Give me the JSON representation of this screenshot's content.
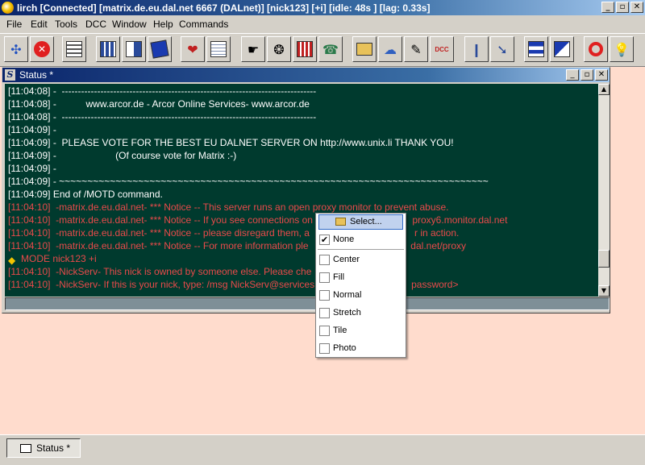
{
  "window": {
    "title": "lirch [Connected] [matrix.de.eu.dal.net 6667 (DALnet)] [nick123] [+i] [idle: 48s ] [lag: 0.33s]",
    "minimize_glyph": "_",
    "maximize_glyph": "▫",
    "close_glyph": "✕"
  },
  "menu": {
    "items": [
      "File",
      "Edit",
      "Tools",
      "DCC",
      "Window",
      "Help",
      "Commands"
    ]
  },
  "toolbar": {
    "buttons": [
      {
        "icon": "connect-icon"
      },
      {
        "icon": "disconnect-icon"
      },
      {
        "icon": "options-icon"
      },
      {
        "icon": "channels-list-icon"
      },
      {
        "icon": "channel-folder-icon"
      },
      {
        "icon": "notify-icon"
      },
      {
        "icon": "address-book-icon"
      },
      {
        "icon": "log-icon"
      },
      {
        "icon": "url-catcher-icon"
      },
      {
        "icon": "scripts-icon"
      },
      {
        "icon": "colors-icon"
      },
      {
        "icon": "dcc-chat-icon"
      },
      {
        "icon": "folder-icon"
      },
      {
        "icon": "query-icon"
      },
      {
        "icon": "edit-icon"
      },
      {
        "icon": "dcc-send-icon"
      },
      {
        "icon": "highlight-icon"
      },
      {
        "icon": "arrange-icon"
      },
      {
        "icon": "tile-horizontal-icon"
      },
      {
        "icon": "tile-cascade-icon"
      },
      {
        "icon": "help-icon"
      },
      {
        "icon": "tips-icon"
      }
    ],
    "dcc_label": "DCC"
  },
  "status_window": {
    "title": "Status *",
    "icon_letter": "S",
    "lines": [
      {
        "text": "[11:04:08] -  -------------------------------------------------------------------------------",
        "color": "white"
      },
      {
        "text": "[11:04:08] -           www.arcor.de - Arcor Online Services- www.arcor.de",
        "color": "white"
      },
      {
        "text": "[11:04:08] -  -------------------------------------------------------------------------------",
        "color": "white"
      },
      {
        "text": "[11:04:09] -",
        "color": "white"
      },
      {
        "text": "[11:04:09] -  PLEASE VOTE FOR THE BEST EU DALNET SERVER ON http://www.unix.li THANK YOU!",
        "color": "white"
      },
      {
        "text": "[11:04:09] -                      (Of course vote for Matrix :-)",
        "color": "white"
      },
      {
        "text": "[11:04:09] -",
        "color": "white"
      },
      {
        "text": "[11:04:09] - ~~~~~~~~~~~~~~~~~~~~~~~~~~~~~~~~~~~~~~~~~~~~~~~~~~~~~~~~~~~~~~~~~~~~~~~~~~~~",
        "color": "white"
      },
      {
        "text": "[11:04:09] End of /MOTD command.",
        "color": "white"
      },
      {
        "text": "[11:04:10]  -matrix.de.eu.dal.net- *** Notice -- This server runs an open proxy monitor to prevent abuse.",
        "color": "red"
      },
      {
        "text": "[11:04:10]  -matrix.de.eu.dal.net- *** Notice -- If you see connections on                                     proxy6.monitor.dal.net",
        "color": "red"
      },
      {
        "text": "[11:04:10]  -matrix.de.eu.dal.net- *** Notice -- please disregard them, a                                       r in action.",
        "color": "red"
      },
      {
        "text": "[11:04:10]  -matrix.de.eu.dal.net- *** Notice -- For more information ple                                      dal.net/proxy",
        "color": "red"
      },
      {
        "text": "MODE nick123 +i",
        "color": "red",
        "mode_icon": true
      },
      {
        "text": "[11:04:10]  -NickServ- This nick is owned by someone else. Please che",
        "color": "red"
      },
      {
        "text": "[11:04:10]  -NickServ- If this is your nick, type: /msg NickServ@services                                    password>",
        "color": "red"
      }
    ]
  },
  "context_menu": {
    "select_label": "Select...",
    "items": [
      {
        "label": "None",
        "checked": true
      },
      {
        "label": "Center",
        "checked": false
      },
      {
        "label": "Fill",
        "checked": false
      },
      {
        "label": "Normal",
        "checked": false
      },
      {
        "label": "Stretch",
        "checked": false
      },
      {
        "label": "Tile",
        "checked": false
      },
      {
        "label": "Photo",
        "checked": false
      }
    ],
    "check_glyph": "✔"
  },
  "taskbar": {
    "button_label": "Status *"
  },
  "colors": {
    "background": "#ffdccd",
    "text_area": "#003a2e",
    "notice_red": "#e84a4a",
    "title_blue": "#0a246a"
  }
}
